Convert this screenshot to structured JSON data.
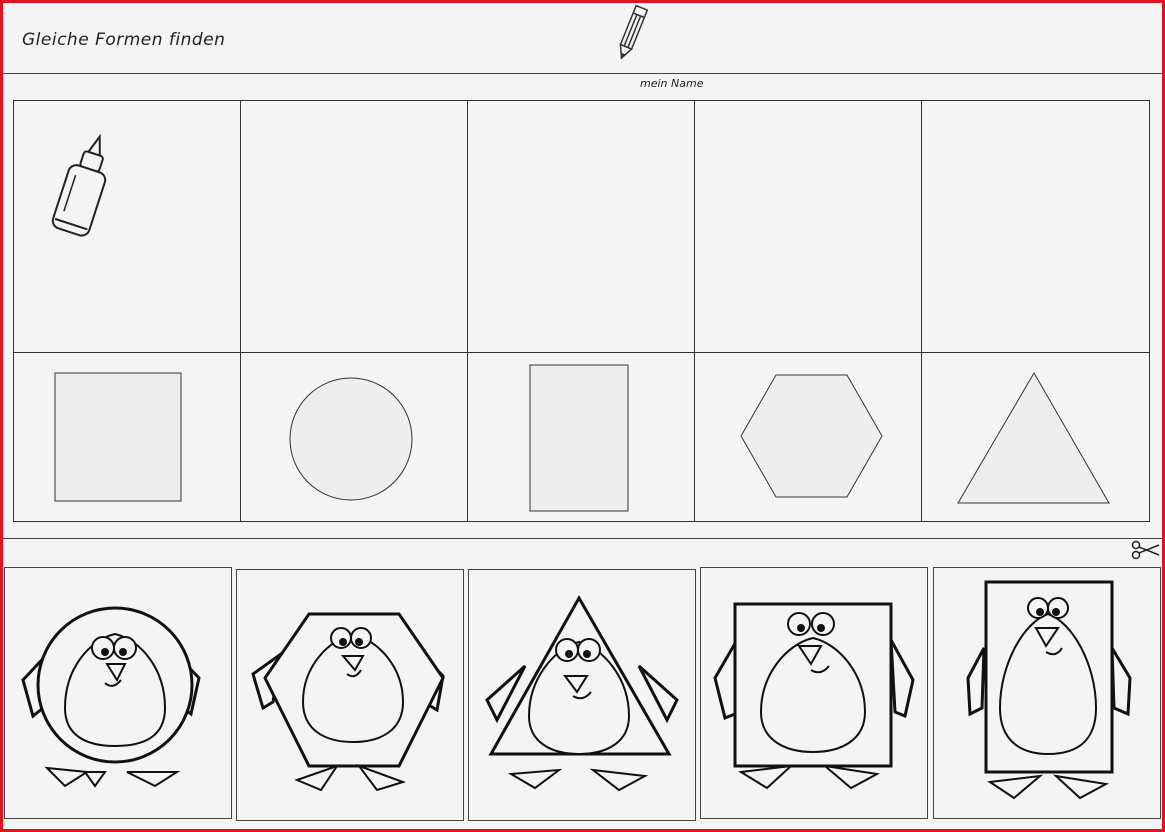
{
  "worksheet": {
    "title": "Gleiche Formen finden",
    "name_label": "mein Name"
  },
  "header_icons": {
    "pencil": "pencil-icon",
    "glue": "glue-bottle-icon",
    "scissors": "scissors-icon"
  },
  "shapes": [
    "square",
    "circle",
    "rectangle",
    "hexagon",
    "triangle"
  ],
  "penguin_cards": [
    "circle-penguin",
    "hexagon-penguin",
    "triangle-penguin",
    "square-penguin",
    "rectangle-penguin"
  ],
  "colors": {
    "border": "#e0141e",
    "line": "#333333",
    "shape_fill": "#eeeeee"
  }
}
